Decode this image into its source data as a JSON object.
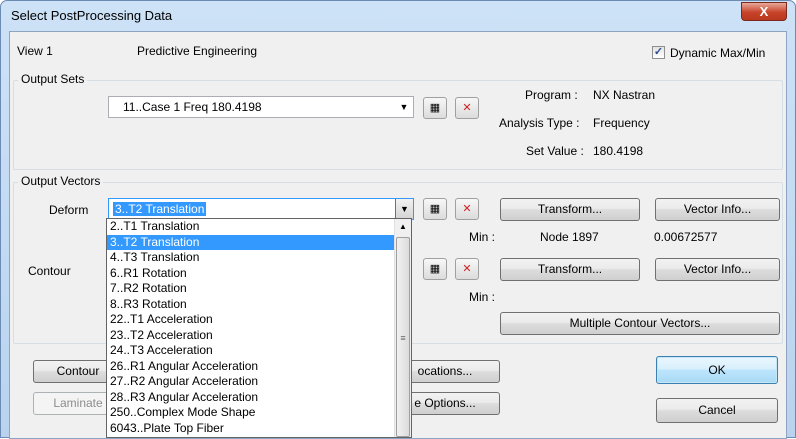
{
  "window": {
    "title": "Select PostProcessing Data",
    "close_glyph": "X"
  },
  "header": {
    "view_label": "View 1",
    "view_name": "Predictive Engineering",
    "dynamic_label": "Dynamic Max/Min",
    "dynamic_checked": true
  },
  "output_sets": {
    "group_label": "Output Sets",
    "selected": "11..Case 1 Freq 180.4198",
    "program_label": "Program :",
    "program_value": "NX Nastran",
    "analysis_label": "Analysis Type :",
    "analysis_value": "Frequency",
    "setvalue_label": "Set Value :",
    "setvalue_value": "180.4198"
  },
  "output_vectors": {
    "group_label": "Output Vectors",
    "deform_label": "Deform",
    "deform_selected": "3..T2 Translation",
    "contour_label": "Contour",
    "transform_label": "Transform...",
    "vector_info_label": "Vector Info...",
    "min_label": "Min :",
    "node_text": "Node  1897",
    "min_value": "0.00672577",
    "multiple_contour_label": "Multiple Contour Vectors..."
  },
  "dropdown_items": [
    "2..T1 Translation",
    "3..T2 Translation",
    "4..T3 Translation",
    "6..R1 Rotation",
    "7..R2 Rotation",
    "8..R3 Rotation",
    "22..T1 Acceleration",
    "23..T2 Acceleration",
    "24..T3 Acceleration",
    "26..R1 Angular Acceleration",
    "27..R2 Angular Acceleration",
    "28..R3 Angular Acceleration",
    "250..Complex Mode Shape",
    "6043..Plate Top Fiber"
  ],
  "dropdown_selected_index": 1,
  "bottom": {
    "contour_btn": "Contour",
    "laminate_btn": "Laminate",
    "locations_btn": "ocations...",
    "options_btn": "e Options...",
    "ok_btn": "OK",
    "cancel_btn": "Cancel"
  }
}
